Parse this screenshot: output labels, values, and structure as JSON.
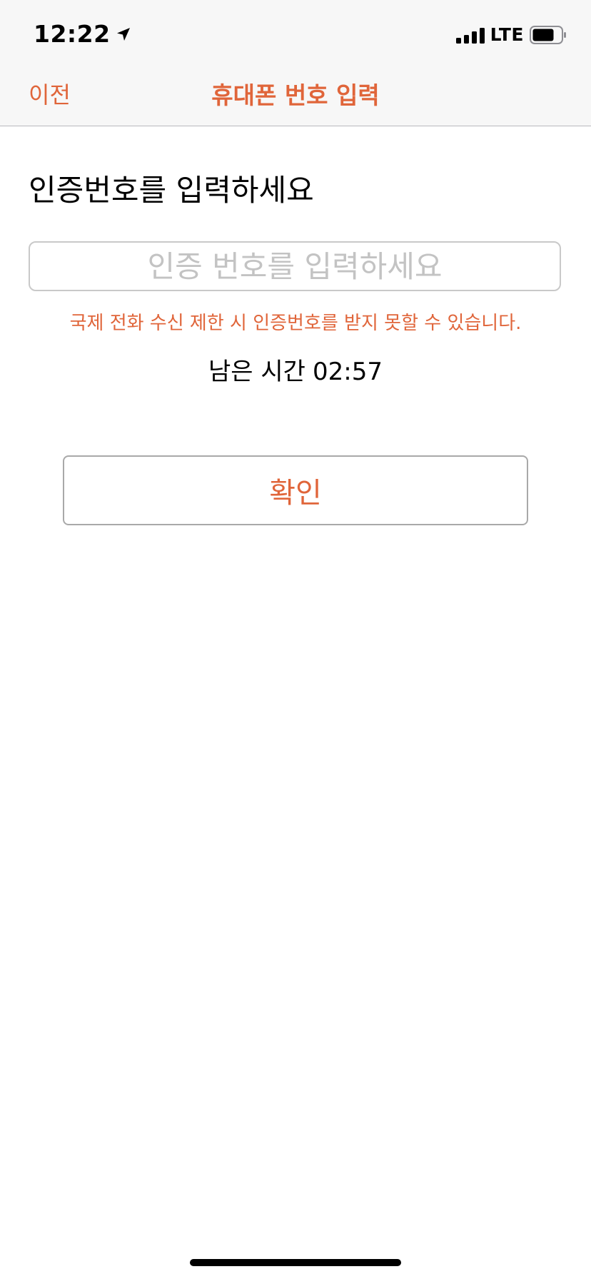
{
  "status_bar": {
    "time": "12:22",
    "location_icon": "location-arrow-icon",
    "signal_icon": "cellular-signal-icon",
    "network": "LTE",
    "battery_icon": "battery-icon"
  },
  "nav": {
    "back_label": "이전",
    "title": "휴대폰 번호 입력"
  },
  "form": {
    "heading": "인증번호를 입력하세요",
    "code_input": {
      "value": "",
      "placeholder": "인증 번호를 입력하세요"
    },
    "warning": "국제 전화 수신 제한 시 인증번호를 받지 못할 수 있습니다.",
    "timer_label": "남은 시간",
    "timer_value": "02:57",
    "confirm_label": "확인"
  },
  "colors": {
    "accent": "#e0653a",
    "nav_background": "#f7f7f7",
    "placeholder": "#c3c3c3"
  }
}
